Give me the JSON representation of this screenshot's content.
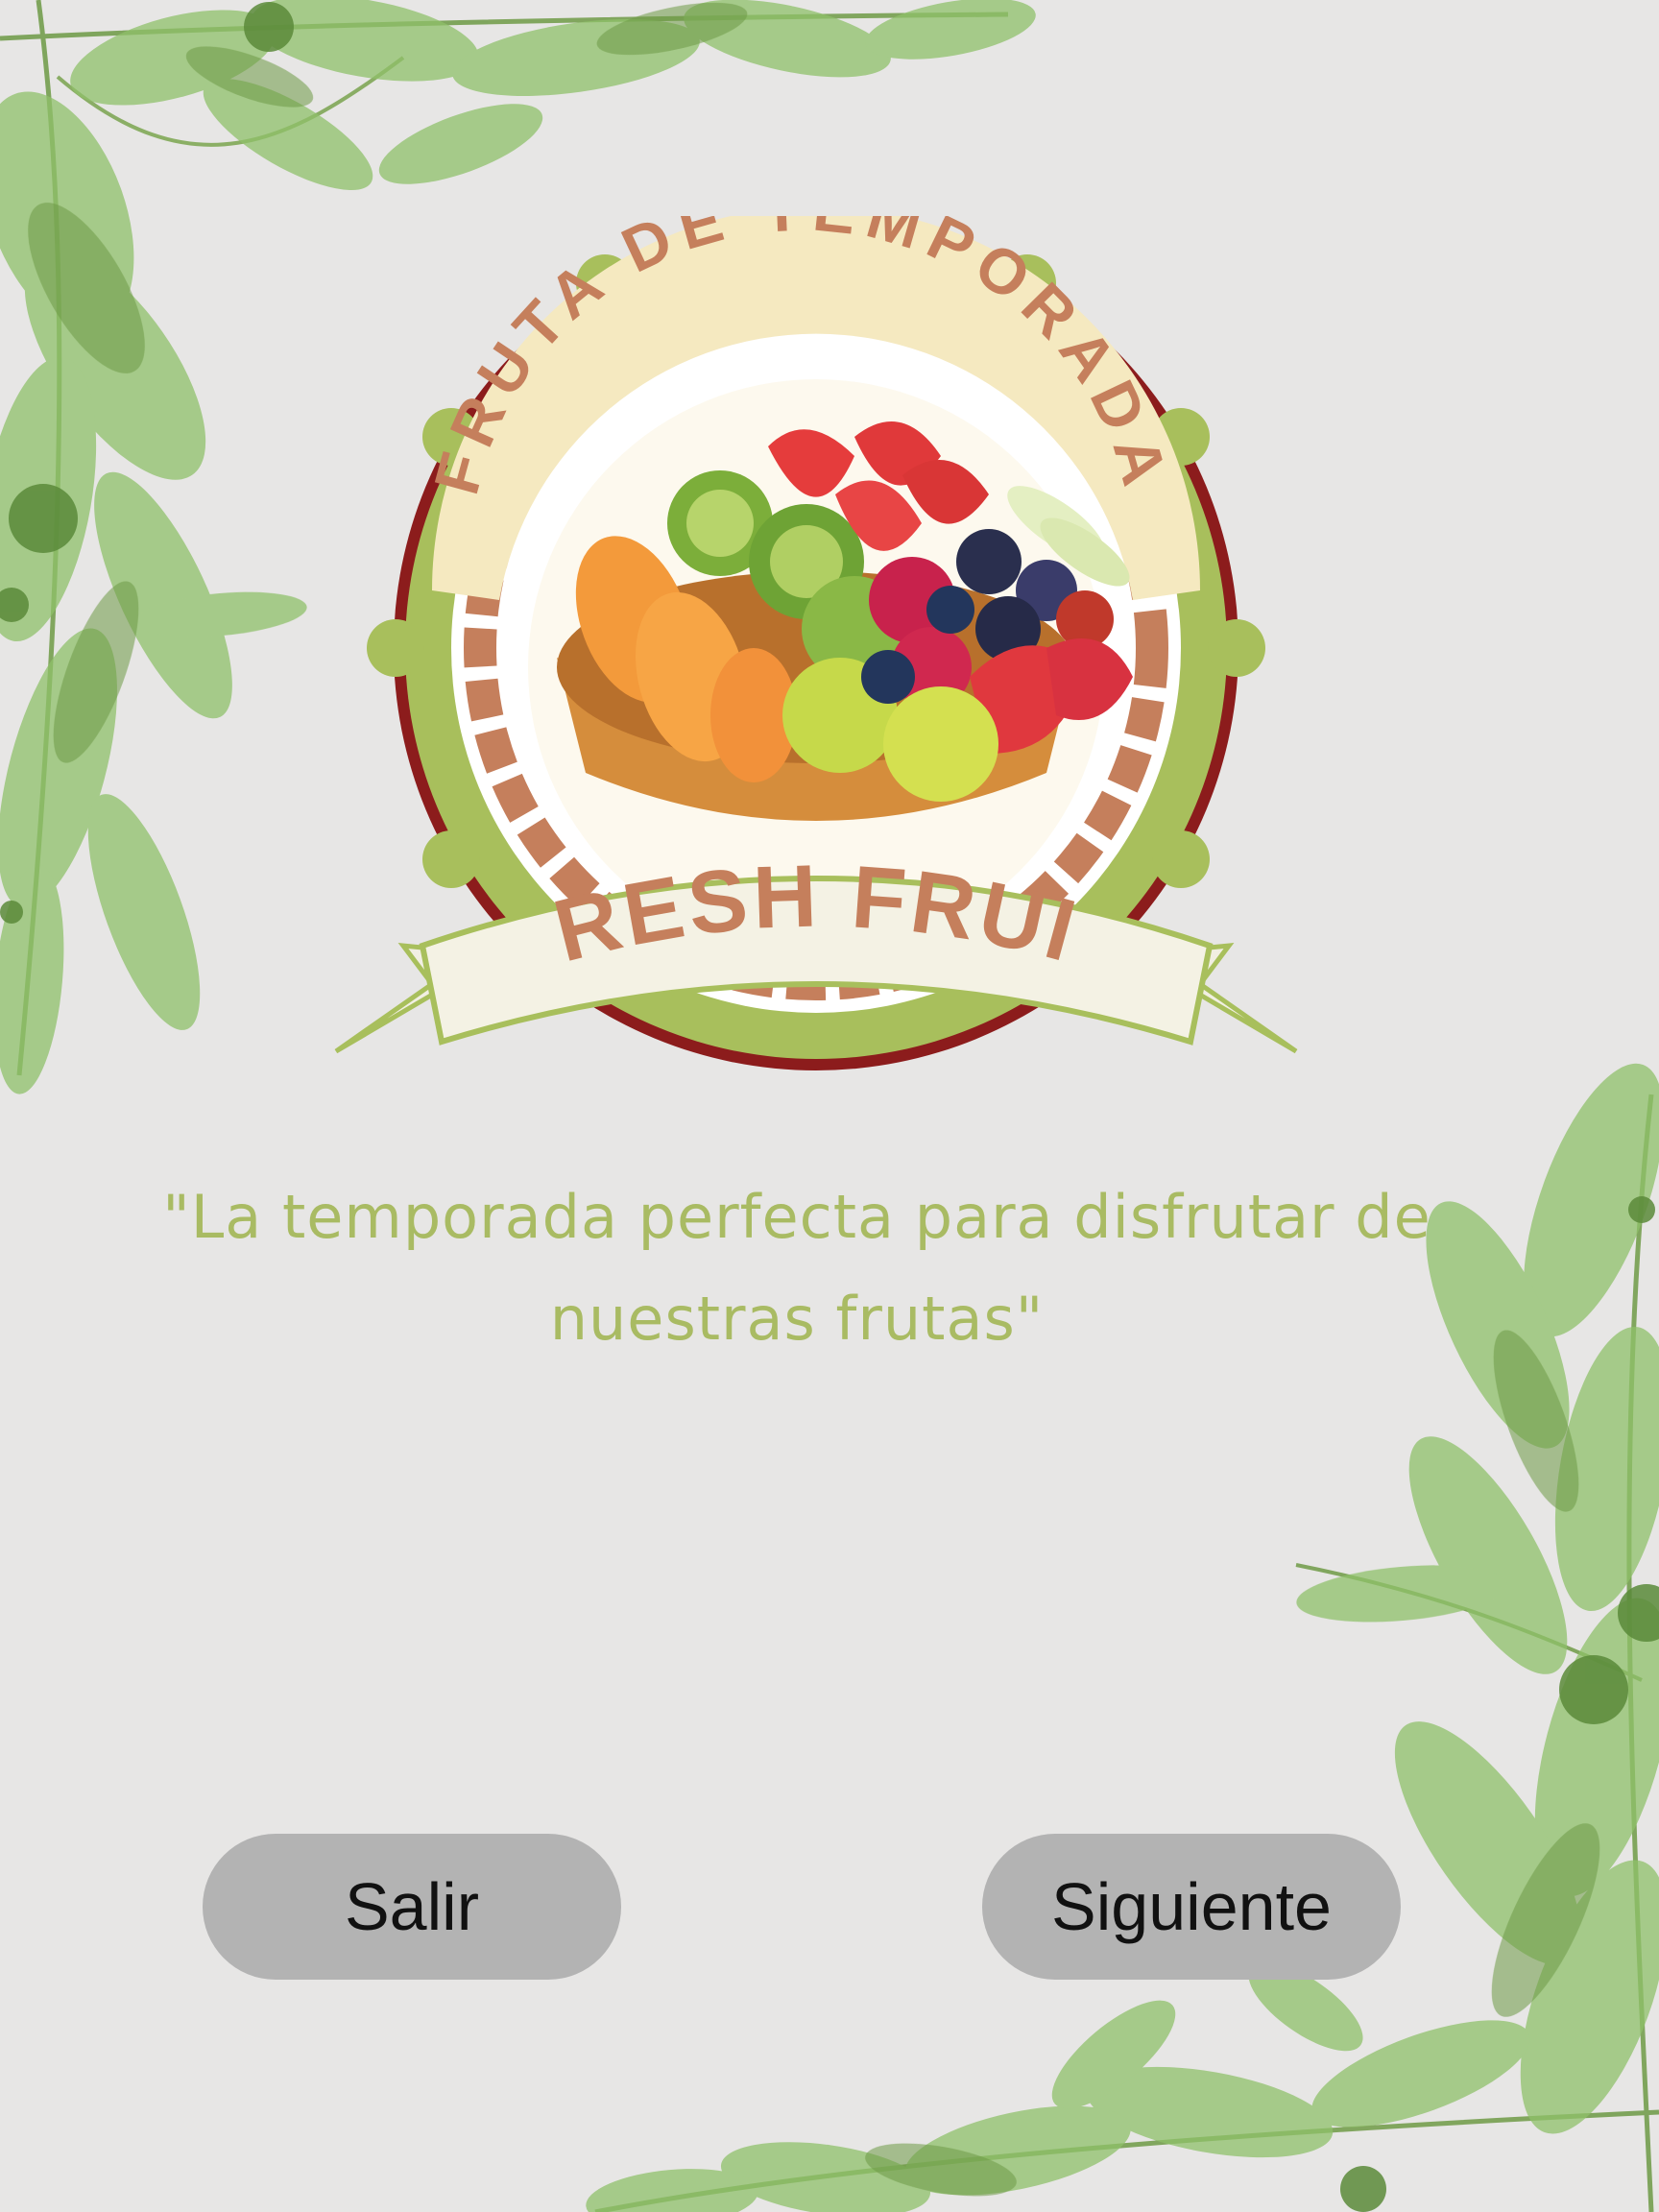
{
  "badge": {
    "arc_text": "FRUTA DE TEMPORADA",
    "ribbon_text": "FRESH FRUIT",
    "icon": "fruit-tart-icon"
  },
  "tagline": {
    "line1": "\"La temporada perfecta para disfrutar de",
    "line2": "nuestras frutas\""
  },
  "buttons": {
    "exit_label": "Salir",
    "next_label": "Siguiente"
  },
  "colors": {
    "background": "#e7e6e5",
    "tagline": "#a9bb63",
    "button": "#b3b3b3",
    "badge_green": "#a8bf5c",
    "badge_red": "#8c1c1c",
    "badge_brown": "#c57f5c",
    "leaf_green": "#7fb24f"
  }
}
